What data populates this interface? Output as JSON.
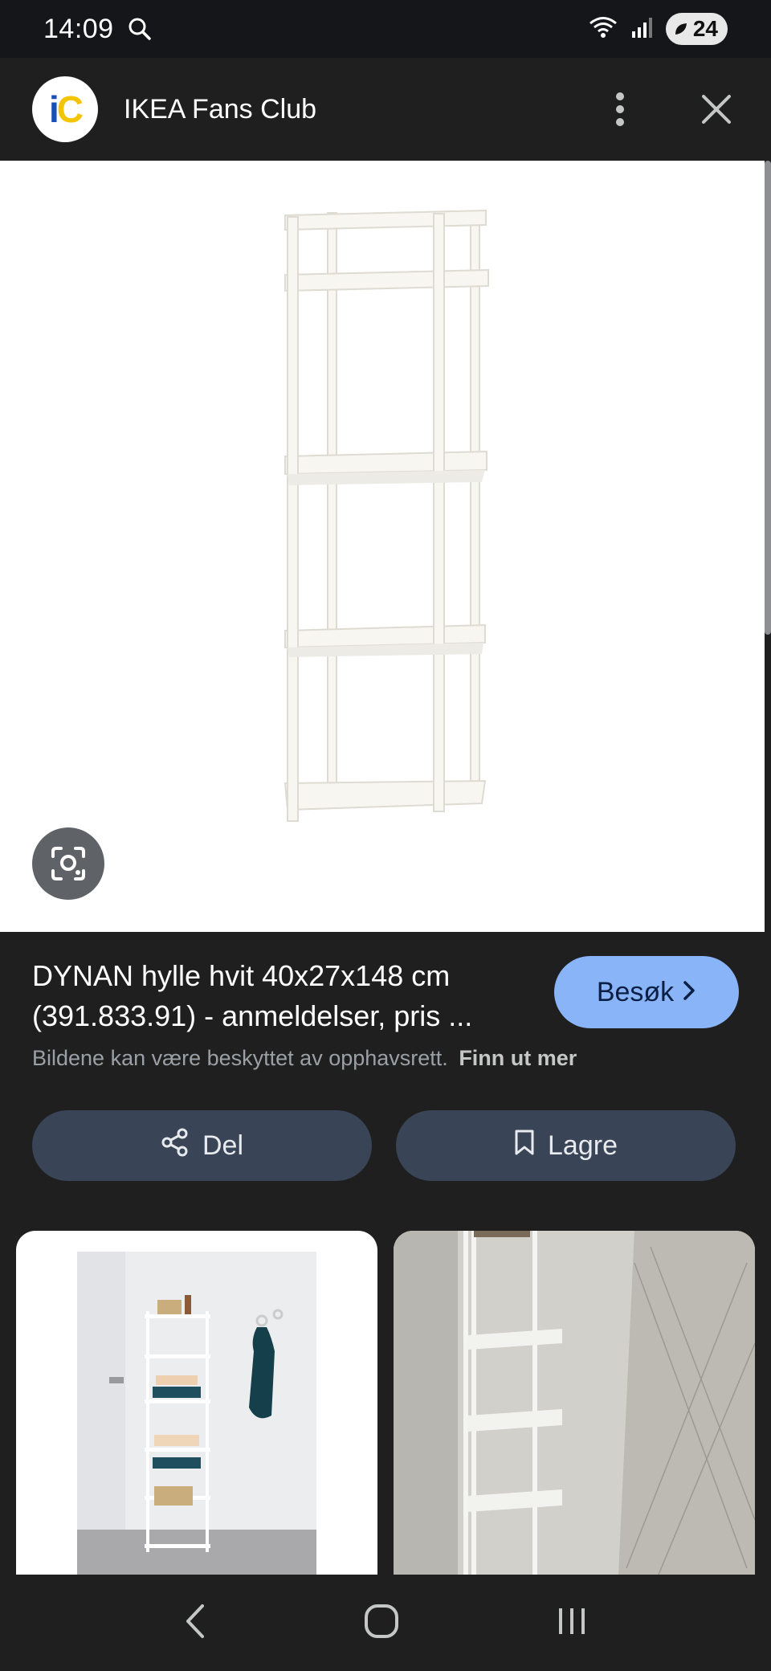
{
  "status_bar": {
    "time": "14:09",
    "battery_level": "24"
  },
  "header": {
    "logo_text_i": "i",
    "logo_text_c": "C",
    "title": "IKEA Fans Club"
  },
  "product": {
    "title": "DYNAN hylle hvit 40x27x148 cm (391.833.91) - anmeldelser, pris ...",
    "visit_label": "Besøk",
    "copyright_text": "Bildene kan være beskyttet av opphavsrett.",
    "learn_more": "Finn ut mer"
  },
  "actions": {
    "share_label": "Del",
    "save_label": "Lagre"
  },
  "colors": {
    "background": "#1f1f1f",
    "status_bar": "#15161a",
    "accent_button": "#8ab4f8",
    "pill_button": "#394457"
  },
  "icons": [
    "search-icon",
    "wifi-icon",
    "signal-icon",
    "battery-icon",
    "more-vert-icon",
    "close-icon",
    "lens-icon",
    "share-icon",
    "bookmark-icon",
    "chevron-right-icon",
    "back-icon",
    "home-icon",
    "recents-icon"
  ]
}
